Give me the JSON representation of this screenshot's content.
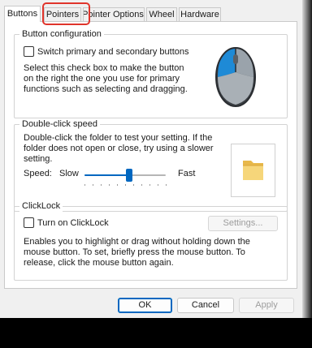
{
  "tabs": [
    {
      "label": "Buttons",
      "active": true
    },
    {
      "label": "Pointers",
      "active": false
    },
    {
      "label": "Pointer Options",
      "active": false
    },
    {
      "label": "Wheel",
      "active": false
    },
    {
      "label": "Hardware",
      "active": false
    }
  ],
  "highlight_color": "#e0342b",
  "button_config": {
    "legend": "Button configuration",
    "switch_label": "Switch primary and secondary buttons",
    "switch_checked": false,
    "description": "Select this check box to make the button on the right the one you use for primary functions such as selecting and dragging.",
    "image_icon": "mouse-icon"
  },
  "double_click": {
    "legend": "Double-click speed",
    "description": "Double-click the folder to test your setting. If the folder does not open or close, try using a slower setting.",
    "speed_label": "Speed:",
    "slow_label": "Slow",
    "fast_label": "Fast",
    "speed_fraction": 0.55,
    "test_icon": "folder-icon"
  },
  "clicklock": {
    "legend": "ClickLock",
    "turn_on_label": "Turn on ClickLock",
    "turn_on_checked": false,
    "settings_label": "Settings...",
    "description": "Enables you to highlight or drag without holding down the mouse button. To set, briefly press the mouse button. To release, click the mouse button again."
  },
  "footer": {
    "ok": "OK",
    "cancel": "Cancel",
    "apply": "Apply"
  },
  "colors": {
    "accent": "#0067c0",
    "mouse_button_highlight": "#1e8ad6"
  }
}
